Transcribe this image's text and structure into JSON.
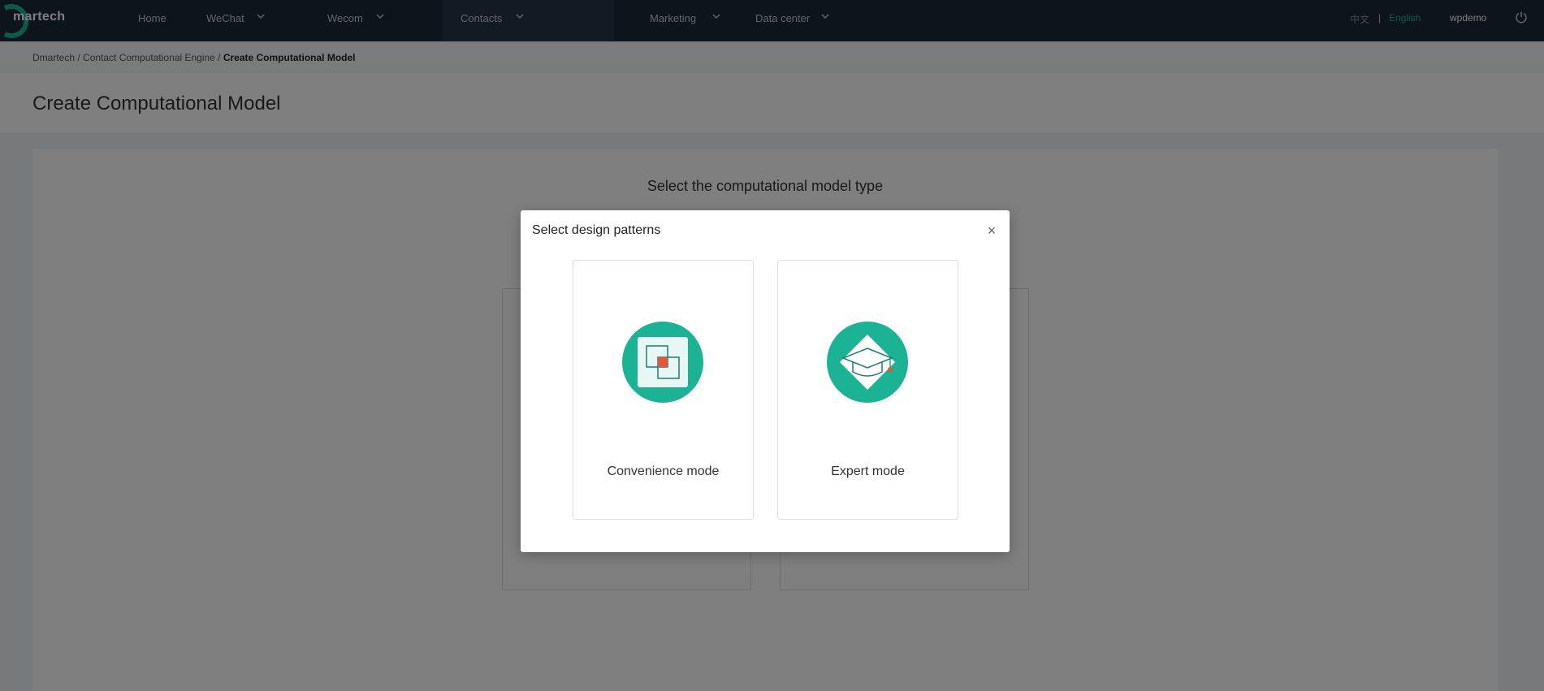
{
  "brand": {
    "logo_text": "martech",
    "accent": "#1bb394"
  },
  "nav": {
    "items": [
      {
        "label": "Home"
      },
      {
        "label": "WeChat"
      },
      {
        "label": "Wecom"
      },
      {
        "label": "Contacts"
      },
      {
        "label": "Marketing"
      },
      {
        "label": "Data center"
      }
    ],
    "active": "Contacts",
    "lang_cn": "中文",
    "lang_sep": "|",
    "lang_en": "English",
    "user": "wpdemo"
  },
  "breadcrumb": {
    "items": [
      "Dmartech",
      "Contact Computational Engine"
    ],
    "sep": " / ",
    "current": "Create Computational Model"
  },
  "page": {
    "title": "Create Computational Model",
    "heading": "Select the computational model type"
  },
  "modal": {
    "title": "Select design patterns",
    "close": "×",
    "options": [
      {
        "label": "Convenience mode",
        "icon": "overlap-squares-icon"
      },
      {
        "label": "Expert mode",
        "icon": "graduation-cap-icon"
      }
    ]
  }
}
